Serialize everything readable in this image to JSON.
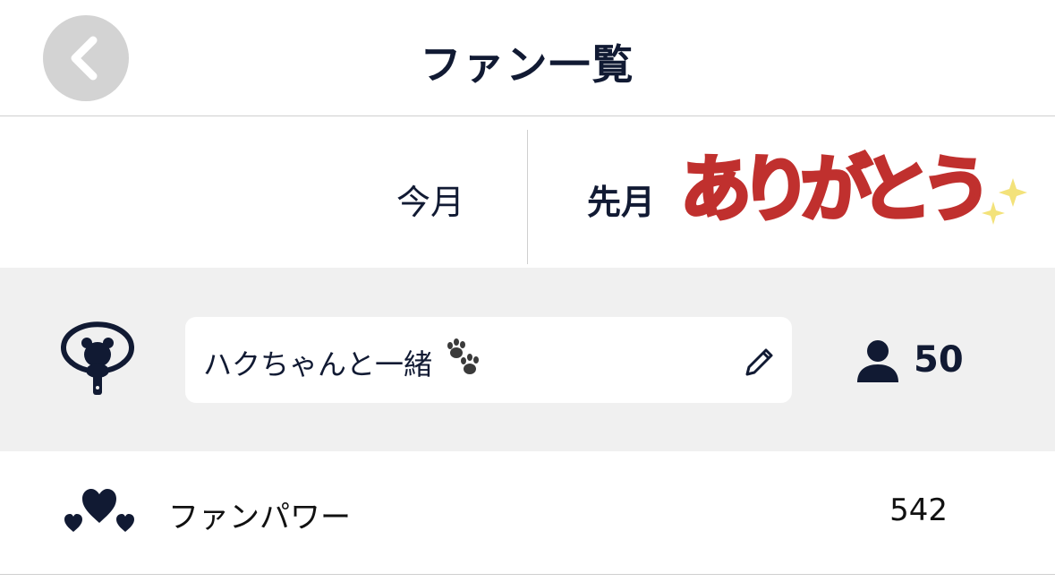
{
  "header": {
    "title": "ファン一覧"
  },
  "tabs": {
    "this_month": "今月",
    "last_month": "先月",
    "thanks_banner": "ありがとう"
  },
  "fan_club": {
    "name": "ハクちゃんと一緒",
    "member_count": "50"
  },
  "fan_power": {
    "label": "ファンパワー",
    "value": "542"
  },
  "icons": {
    "back": "chevron-left-icon",
    "fan_club": "bear-fan-icon",
    "paw": "paw-icon",
    "edit": "pencil-icon",
    "members": "person-icon",
    "power": "hearts-icon",
    "sparkle": "sparkle-icon"
  },
  "colors": {
    "text_primary": "#111a33",
    "thanks_red": "#c0302e",
    "sparkle_yellow": "#f3e27a",
    "section_gray": "#f0f0f0",
    "back_button_gray": "#d3d3d3"
  }
}
